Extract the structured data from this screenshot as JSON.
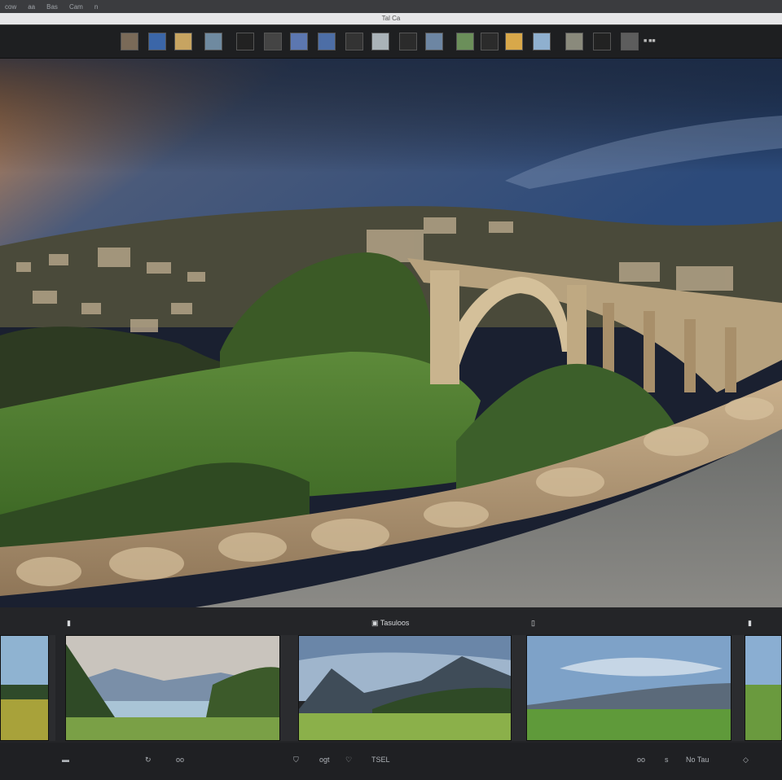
{
  "menubar": {
    "items": [
      "cow",
      "aa",
      "Bas",
      "Cam",
      "n"
    ]
  },
  "window": {
    "title": "Tal Ca"
  },
  "filmstrip": {
    "count_label": "■ ■■",
    "thumbs": [
      {
        "color": "#7a6a58"
      },
      {
        "color": "#3b66a8"
      },
      {
        "color": "#c7a461"
      },
      {
        "color": "#6f8aa0"
      },
      {
        "color": "#222"
      },
      {
        "color": "#444"
      },
      {
        "color": "#5c77b0"
      },
      {
        "color": "#4d6ea6"
      },
      {
        "color": "#333"
      },
      {
        "color": "#aab3b8"
      },
      {
        "color": "#2b2b2b"
      },
      {
        "color": "#6d86a3"
      },
      {
        "color": "#6b8f5a"
      },
      {
        "color": "#2b2b2b"
      },
      {
        "color": "#d8a84a"
      },
      {
        "color": "#8fb0cf"
      },
      {
        "color": "#8a8a7c"
      },
      {
        "color": "#222"
      },
      {
        "color": "#5d5d5d"
      }
    ]
  },
  "panel": {
    "title": "Tasuloos",
    "cards": [
      "lake-valley",
      "mountain-meadow",
      "sunny-field",
      "edge-field"
    ]
  },
  "toolbar": {
    "left_label": "oo",
    "mid_labels": [
      "ogt",
      "TSEL"
    ],
    "right_labels": [
      "oo",
      "s",
      "No Tau"
    ]
  },
  "colors": {
    "accent": "#d7d9dc",
    "panel_bg": "#242528",
    "bar_bg": "#1f2023"
  }
}
